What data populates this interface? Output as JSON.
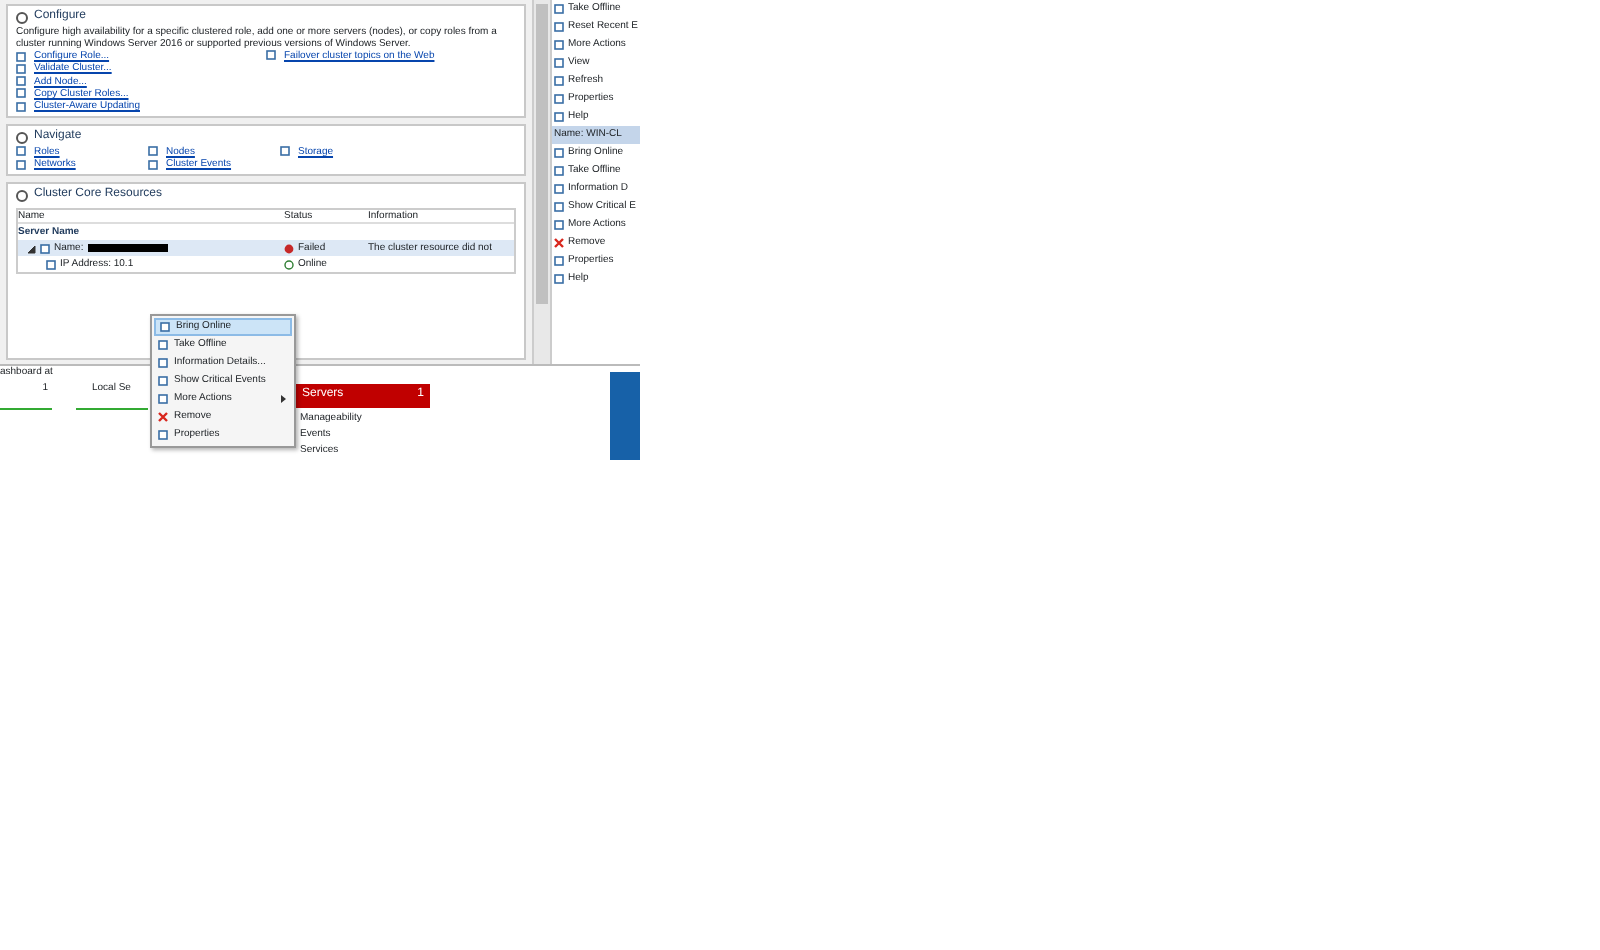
{
  "configure": {
    "title": "Configure",
    "description": "Configure high availability for a specific clustered role, add one or more servers (nodes), or copy roles from a cluster running Windows Server 2016 or supported previous versions of Windows Server.",
    "links": [
      {
        "label": "Configure Role..."
      },
      {
        "label": "Validate Cluster..."
      },
      {
        "label": "Add Node..."
      },
      {
        "label": "Copy Cluster Roles..."
      },
      {
        "label": "Cluster-Aware Updating"
      }
    ],
    "side_link": "Failover cluster topics on the Web"
  },
  "navigate": {
    "title": "Navigate",
    "links": [
      {
        "label": "Roles"
      },
      {
        "label": "Nodes"
      },
      {
        "label": "Storage"
      },
      {
        "label": "Networks"
      },
      {
        "label": "Cluster Events"
      }
    ]
  },
  "core_resources": {
    "title": "Cluster Core Resources",
    "columns": [
      "Name",
      "Status",
      "Information"
    ],
    "group": "Server Name",
    "rows": [
      {
        "name": "Name:",
        "status": "Failed",
        "kind": "failed",
        "information": "The cluster resource did not",
        "selected": true,
        "expanded": true,
        "redacted": true
      },
      {
        "name": "IP Address: 10.1",
        "status": "Online",
        "kind": "online",
        "selected": false
      }
    ]
  },
  "context_menu": [
    {
      "label": "Bring Online",
      "kind": "command",
      "selected": true,
      "submenu": false
    },
    {
      "label": "Take Offline",
      "kind": "command",
      "selected": false,
      "submenu": false
    },
    {
      "label": "Information Details...",
      "kind": "command",
      "selected": false,
      "submenu": false
    },
    {
      "label": "Show Critical Events",
      "kind": "command",
      "selected": false,
      "submenu": false
    },
    {
      "label": "More Actions",
      "kind": "command",
      "selected": false,
      "submenu": true
    },
    {
      "label": "Remove",
      "kind": "delete",
      "selected": false,
      "submenu": false
    },
    {
      "label": "Properties",
      "kind": "command",
      "selected": false,
      "submenu": false
    }
  ],
  "actions": [
    {
      "label": "Take Offline",
      "kind": "item",
      "selected": false
    },
    {
      "label": "Reset Recent E",
      "kind": "item",
      "selected": false
    },
    {
      "label": "More Actions",
      "kind": "item",
      "selected": false
    },
    {
      "label": "View",
      "kind": "item",
      "selected": false
    },
    {
      "label": "Refresh",
      "kind": "item",
      "selected": false
    },
    {
      "label": "Properties",
      "kind": "item",
      "selected": false
    },
    {
      "label": "Help",
      "kind": "item",
      "selected": false
    },
    {
      "label": "Name: WIN-CL",
      "kind": "header",
      "selected": true
    },
    {
      "label": "Bring Online",
      "kind": "item",
      "selected": false
    },
    {
      "label": "Take Offline",
      "kind": "item",
      "selected": false
    },
    {
      "label": "Information D",
      "kind": "item",
      "selected": false
    },
    {
      "label": "Show Critical E",
      "kind": "item",
      "selected": false
    },
    {
      "label": "More Actions",
      "kind": "item",
      "selected": false
    },
    {
      "label": "Remove",
      "kind": "delete",
      "selected": false
    },
    {
      "label": "Properties",
      "kind": "item",
      "selected": false
    },
    {
      "label": "Help",
      "kind": "item",
      "selected": false
    }
  ],
  "dashboard": {
    "title": "ashboard at",
    "tiles": [
      {
        "count": "1",
        "kind": "plain"
      },
      {
        "label": "Local Se",
        "kind": "plain"
      },
      {
        "count": "1",
        "label": "Servers",
        "kind": "alert"
      }
    ],
    "tile_rows": [
      "Manageability",
      "Events",
      "Services"
    ]
  }
}
